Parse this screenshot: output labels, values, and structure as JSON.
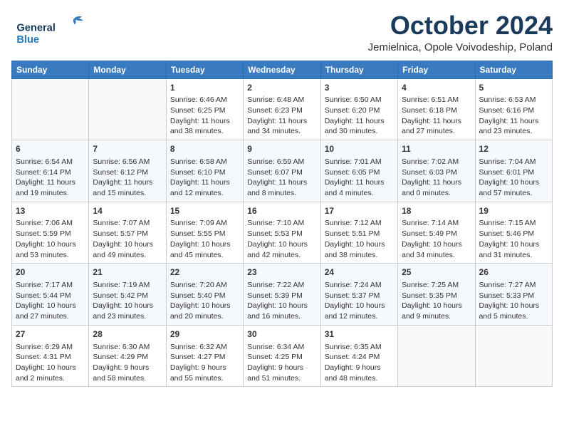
{
  "header": {
    "logo_general": "General",
    "logo_blue": "Blue",
    "month_title": "October 2024",
    "location": "Jemielnica, Opole Voivodeship, Poland"
  },
  "weekdays": [
    "Sunday",
    "Monday",
    "Tuesday",
    "Wednesday",
    "Thursday",
    "Friday",
    "Saturday"
  ],
  "weeks": [
    [
      {
        "day": "",
        "sunrise": "",
        "sunset": "",
        "daylight": ""
      },
      {
        "day": "",
        "sunrise": "",
        "sunset": "",
        "daylight": ""
      },
      {
        "day": "1",
        "sunrise": "Sunrise: 6:46 AM",
        "sunset": "Sunset: 6:25 PM",
        "daylight": "Daylight: 11 hours and 38 minutes."
      },
      {
        "day": "2",
        "sunrise": "Sunrise: 6:48 AM",
        "sunset": "Sunset: 6:23 PM",
        "daylight": "Daylight: 11 hours and 34 minutes."
      },
      {
        "day": "3",
        "sunrise": "Sunrise: 6:50 AM",
        "sunset": "Sunset: 6:20 PM",
        "daylight": "Daylight: 11 hours and 30 minutes."
      },
      {
        "day": "4",
        "sunrise": "Sunrise: 6:51 AM",
        "sunset": "Sunset: 6:18 PM",
        "daylight": "Daylight: 11 hours and 27 minutes."
      },
      {
        "day": "5",
        "sunrise": "Sunrise: 6:53 AM",
        "sunset": "Sunset: 6:16 PM",
        "daylight": "Daylight: 11 hours and 23 minutes."
      }
    ],
    [
      {
        "day": "6",
        "sunrise": "Sunrise: 6:54 AM",
        "sunset": "Sunset: 6:14 PM",
        "daylight": "Daylight: 11 hours and 19 minutes."
      },
      {
        "day": "7",
        "sunrise": "Sunrise: 6:56 AM",
        "sunset": "Sunset: 6:12 PM",
        "daylight": "Daylight: 11 hours and 15 minutes."
      },
      {
        "day": "8",
        "sunrise": "Sunrise: 6:58 AM",
        "sunset": "Sunset: 6:10 PM",
        "daylight": "Daylight: 11 hours and 12 minutes."
      },
      {
        "day": "9",
        "sunrise": "Sunrise: 6:59 AM",
        "sunset": "Sunset: 6:07 PM",
        "daylight": "Daylight: 11 hours and 8 minutes."
      },
      {
        "day": "10",
        "sunrise": "Sunrise: 7:01 AM",
        "sunset": "Sunset: 6:05 PM",
        "daylight": "Daylight: 11 hours and 4 minutes."
      },
      {
        "day": "11",
        "sunrise": "Sunrise: 7:02 AM",
        "sunset": "Sunset: 6:03 PM",
        "daylight": "Daylight: 11 hours and 0 minutes."
      },
      {
        "day": "12",
        "sunrise": "Sunrise: 7:04 AM",
        "sunset": "Sunset: 6:01 PM",
        "daylight": "Daylight: 10 hours and 57 minutes."
      }
    ],
    [
      {
        "day": "13",
        "sunrise": "Sunrise: 7:06 AM",
        "sunset": "Sunset: 5:59 PM",
        "daylight": "Daylight: 10 hours and 53 minutes."
      },
      {
        "day": "14",
        "sunrise": "Sunrise: 7:07 AM",
        "sunset": "Sunset: 5:57 PM",
        "daylight": "Daylight: 10 hours and 49 minutes."
      },
      {
        "day": "15",
        "sunrise": "Sunrise: 7:09 AM",
        "sunset": "Sunset: 5:55 PM",
        "daylight": "Daylight: 10 hours and 45 minutes."
      },
      {
        "day": "16",
        "sunrise": "Sunrise: 7:10 AM",
        "sunset": "Sunset: 5:53 PM",
        "daylight": "Daylight: 10 hours and 42 minutes."
      },
      {
        "day": "17",
        "sunrise": "Sunrise: 7:12 AM",
        "sunset": "Sunset: 5:51 PM",
        "daylight": "Daylight: 10 hours and 38 minutes."
      },
      {
        "day": "18",
        "sunrise": "Sunrise: 7:14 AM",
        "sunset": "Sunset: 5:49 PM",
        "daylight": "Daylight: 10 hours and 34 minutes."
      },
      {
        "day": "19",
        "sunrise": "Sunrise: 7:15 AM",
        "sunset": "Sunset: 5:46 PM",
        "daylight": "Daylight: 10 hours and 31 minutes."
      }
    ],
    [
      {
        "day": "20",
        "sunrise": "Sunrise: 7:17 AM",
        "sunset": "Sunset: 5:44 PM",
        "daylight": "Daylight: 10 hours and 27 minutes."
      },
      {
        "day": "21",
        "sunrise": "Sunrise: 7:19 AM",
        "sunset": "Sunset: 5:42 PM",
        "daylight": "Daylight: 10 hours and 23 minutes."
      },
      {
        "day": "22",
        "sunrise": "Sunrise: 7:20 AM",
        "sunset": "Sunset: 5:40 PM",
        "daylight": "Daylight: 10 hours and 20 minutes."
      },
      {
        "day": "23",
        "sunrise": "Sunrise: 7:22 AM",
        "sunset": "Sunset: 5:39 PM",
        "daylight": "Daylight: 10 hours and 16 minutes."
      },
      {
        "day": "24",
        "sunrise": "Sunrise: 7:24 AM",
        "sunset": "Sunset: 5:37 PM",
        "daylight": "Daylight: 10 hours and 12 minutes."
      },
      {
        "day": "25",
        "sunrise": "Sunrise: 7:25 AM",
        "sunset": "Sunset: 5:35 PM",
        "daylight": "Daylight: 10 hours and 9 minutes."
      },
      {
        "day": "26",
        "sunrise": "Sunrise: 7:27 AM",
        "sunset": "Sunset: 5:33 PM",
        "daylight": "Daylight: 10 hours and 5 minutes."
      }
    ],
    [
      {
        "day": "27",
        "sunrise": "Sunrise: 6:29 AM",
        "sunset": "Sunset: 4:31 PM",
        "daylight": "Daylight: 10 hours and 2 minutes."
      },
      {
        "day": "28",
        "sunrise": "Sunrise: 6:30 AM",
        "sunset": "Sunset: 4:29 PM",
        "daylight": "Daylight: 9 hours and 58 minutes."
      },
      {
        "day": "29",
        "sunrise": "Sunrise: 6:32 AM",
        "sunset": "Sunset: 4:27 PM",
        "daylight": "Daylight: 9 hours and 55 minutes."
      },
      {
        "day": "30",
        "sunrise": "Sunrise: 6:34 AM",
        "sunset": "Sunset: 4:25 PM",
        "daylight": "Daylight: 9 hours and 51 minutes."
      },
      {
        "day": "31",
        "sunrise": "Sunrise: 6:35 AM",
        "sunset": "Sunset: 4:24 PM",
        "daylight": "Daylight: 9 hours and 48 minutes."
      },
      {
        "day": "",
        "sunrise": "",
        "sunset": "",
        "daylight": ""
      },
      {
        "day": "",
        "sunrise": "",
        "sunset": "",
        "daylight": ""
      }
    ]
  ]
}
